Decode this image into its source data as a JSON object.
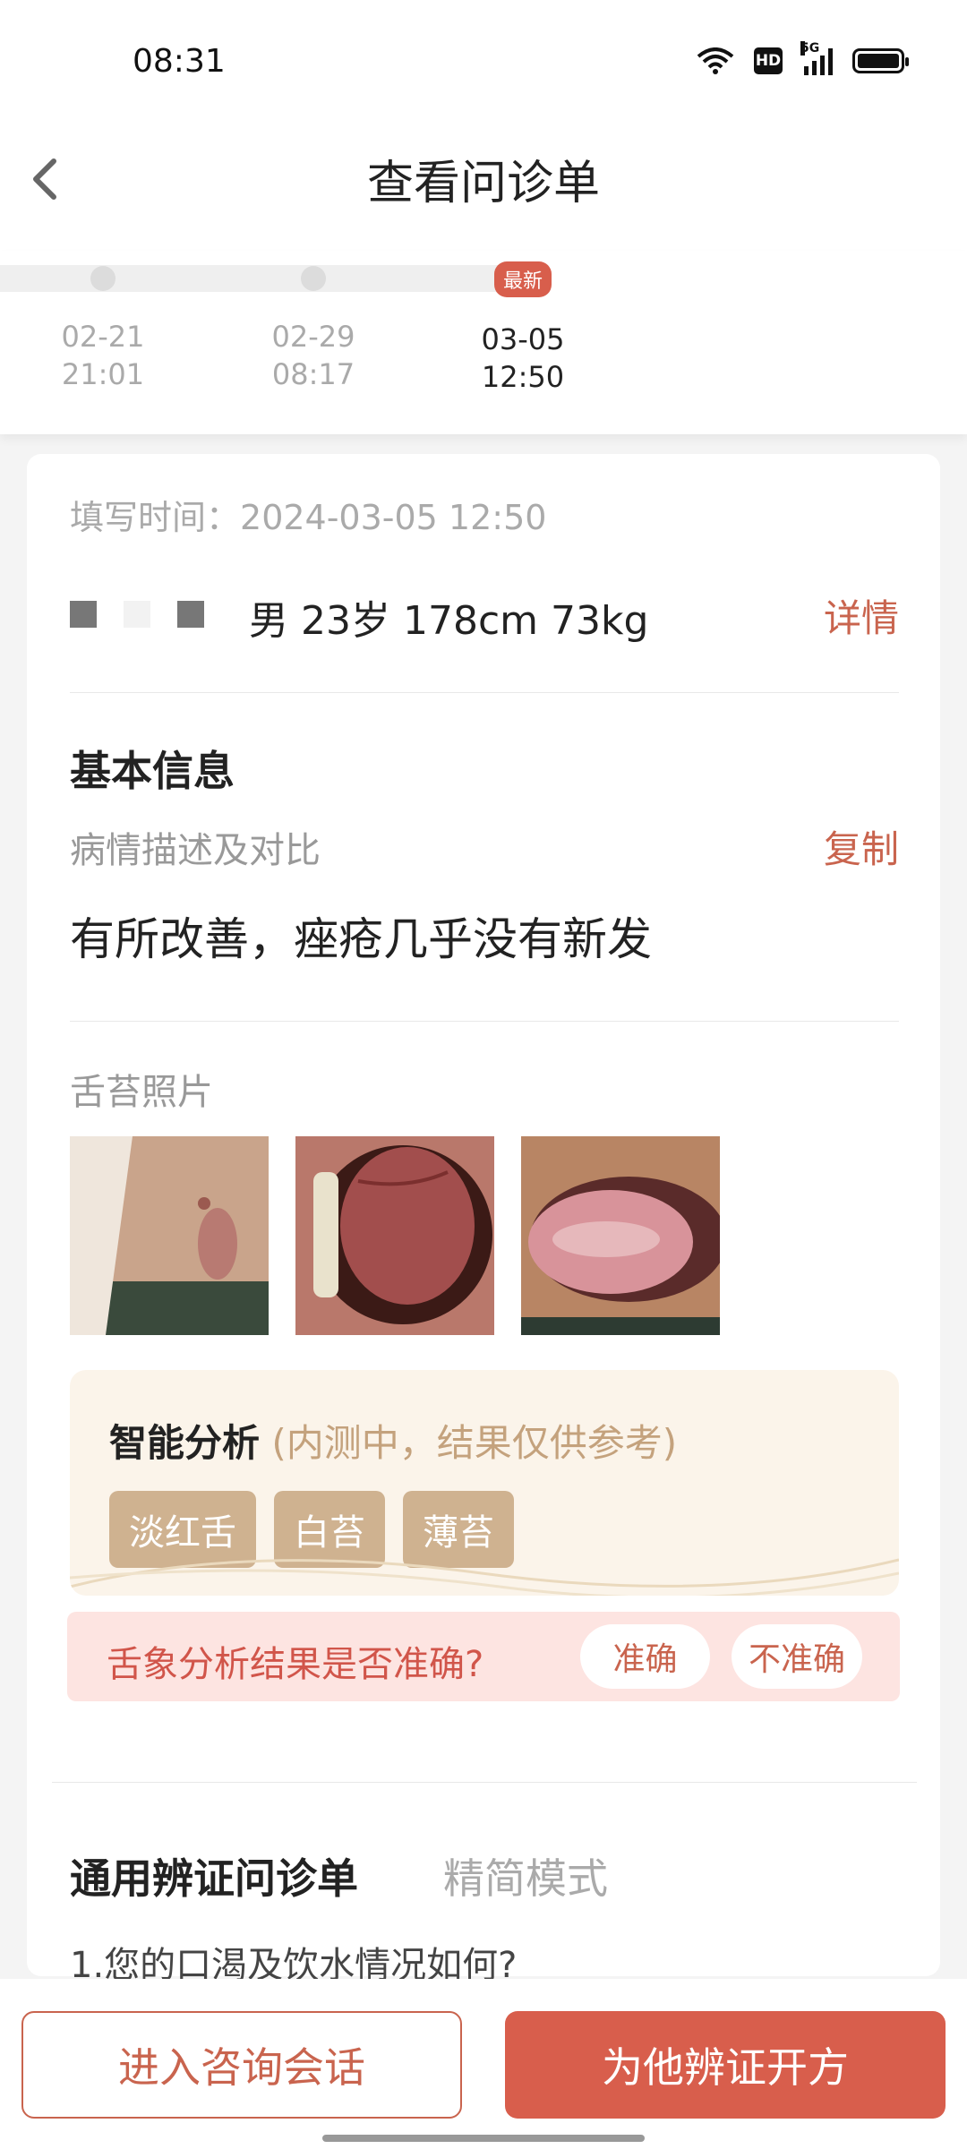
{
  "status_bar": {
    "time": "08:31",
    "network_label": "5G",
    "hd_label": "HD",
    "icons": [
      "wifi-icon",
      "hd-icon",
      "signal-5g-icon",
      "battery-icon"
    ]
  },
  "header": {
    "title": "查看问诊单",
    "back_icon": "back-arrow-icon"
  },
  "timeline": {
    "items": [
      {
        "date": "02-21",
        "time": "21:01",
        "active": false
      },
      {
        "date": "02-29",
        "time": "08:17",
        "active": false
      },
      {
        "date": "03-05",
        "time": "12:50",
        "active": true,
        "badge": "最新"
      }
    ]
  },
  "record": {
    "fill_time_label": "填写时间：",
    "fill_time": "2024-03-05 12:50",
    "patient_info": "男 23岁 178cm 73kg",
    "details_link": "详情"
  },
  "basic_info": {
    "title": "基本信息",
    "description_label": "病情描述及对比",
    "copy_label": "复制",
    "description": "有所改善，痤疮几乎没有新发"
  },
  "tongue": {
    "photos_label": "舌苔照片",
    "analysis_title": "智能分析",
    "analysis_note": "(内测中，结果仅供参考)",
    "tags": [
      "淡红舌",
      "白苔",
      "薄苔"
    ],
    "feedback_question": "舌象分析结果是否准确?",
    "accurate_label": "准确",
    "inaccurate_label": "不准确"
  },
  "questionnaire": {
    "tab_general": "通用辨证问诊单",
    "tab_simple": "精简模式",
    "first_question": "1.您的口渴及饮水情况如何?"
  },
  "actions": {
    "enter_chat": "进入咨询会话",
    "prescribe": "为他辨证开方"
  },
  "colors": {
    "accent": "#d85e4c",
    "link": "#c9644e",
    "tag": "#cfb290",
    "analysis_bg": "#fbf4ea",
    "feedback_bg": "#fde4e1"
  }
}
